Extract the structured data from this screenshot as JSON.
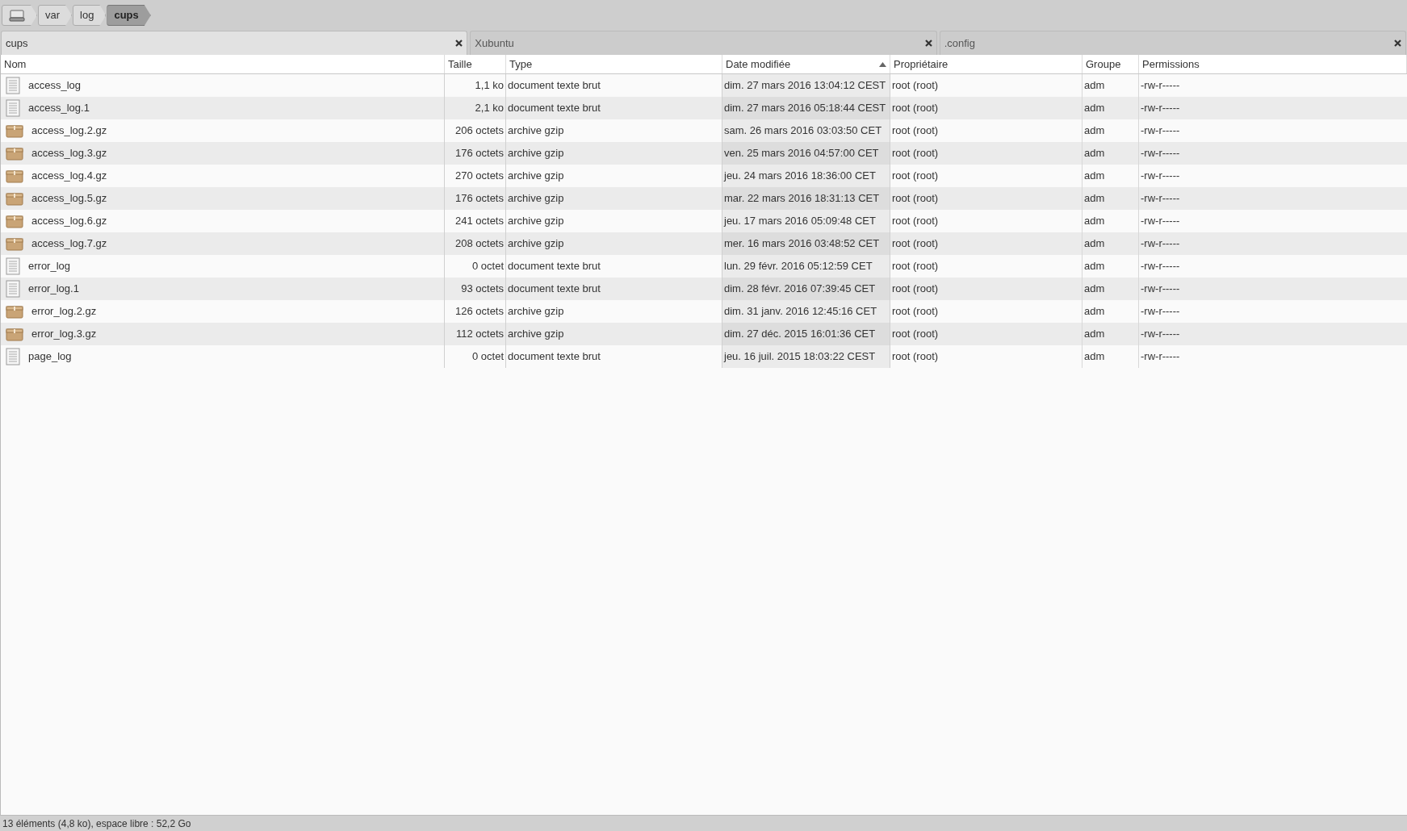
{
  "breadcrumb": [
    {
      "kind": "drive",
      "selected": false
    },
    {
      "kind": "folder",
      "label": "var",
      "selected": false
    },
    {
      "kind": "folder",
      "label": "log",
      "selected": false
    },
    {
      "kind": "folder",
      "label": "cups",
      "selected": true
    }
  ],
  "tabs": [
    {
      "label": "cups",
      "selected": true
    },
    {
      "label": "Xubuntu",
      "selected": false
    },
    {
      "label": ".config",
      "selected": false
    }
  ],
  "table": {
    "columns": [
      {
        "label": "Nom",
        "sorted": false
      },
      {
        "label": "Taille",
        "sorted": false
      },
      {
        "label": "Type",
        "sorted": false
      },
      {
        "label": "Date modifiée",
        "sorted": true
      },
      {
        "label": "Propriétaire",
        "sorted": false
      },
      {
        "label": "Groupe",
        "sorted": false
      },
      {
        "label": "Permissions",
        "sorted": false
      }
    ],
    "rows": [
      {
        "kind": "text",
        "cells": [
          "access_log",
          "1,1 ko",
          "document texte brut",
          "dim. 27 mars 2016 13:04:12 CEST",
          "root (root)",
          "adm",
          "-rw-r-----"
        ]
      },
      {
        "kind": "text",
        "cells": [
          "access_log.1",
          "2,1 ko",
          "document texte brut",
          "dim. 27 mars 2016 05:18:44 CEST",
          "root (root)",
          "adm",
          "-rw-r-----"
        ]
      },
      {
        "kind": "archive",
        "cells": [
          "access_log.2.gz",
          "206 octets",
          "archive gzip",
          "sam. 26 mars 2016 03:03:50 CET",
          "root (root)",
          "adm",
          "-rw-r-----"
        ]
      },
      {
        "kind": "archive",
        "cells": [
          "access_log.3.gz",
          "176 octets",
          "archive gzip",
          "ven. 25 mars 2016 04:57:00 CET",
          "root (root)",
          "adm",
          "-rw-r-----"
        ]
      },
      {
        "kind": "archive",
        "cells": [
          "access_log.4.gz",
          "270 octets",
          "archive gzip",
          "jeu. 24 mars 2016 18:36:00 CET",
          "root (root)",
          "adm",
          "-rw-r-----"
        ]
      },
      {
        "kind": "archive",
        "cells": [
          "access_log.5.gz",
          "176 octets",
          "archive gzip",
          "mar. 22 mars 2016 18:31:13 CET",
          "root (root)",
          "adm",
          "-rw-r-----"
        ]
      },
      {
        "kind": "archive",
        "cells": [
          "access_log.6.gz",
          "241 octets",
          "archive gzip",
          "jeu. 17 mars 2016 05:09:48 CET",
          "root (root)",
          "adm",
          "-rw-r-----"
        ]
      },
      {
        "kind": "archive",
        "cells": [
          "access_log.7.gz",
          "208 octets",
          "archive gzip",
          "mer. 16 mars 2016 03:48:52 CET",
          "root (root)",
          "adm",
          "-rw-r-----"
        ]
      },
      {
        "kind": "text",
        "cells": [
          "error_log",
          "0 octet",
          "document texte brut",
          "lun. 29 févr. 2016 05:12:59 CET",
          "root (root)",
          "adm",
          "-rw-r-----"
        ]
      },
      {
        "kind": "text",
        "cells": [
          "error_log.1",
          "93 octets",
          "document texte brut",
          "dim. 28 févr. 2016 07:39:45 CET",
          "root (root)",
          "adm",
          "-rw-r-----"
        ]
      },
      {
        "kind": "archive",
        "cells": [
          "error_log.2.gz",
          "126 octets",
          "archive gzip",
          "dim. 31 janv. 2016 12:45:16 CET",
          "root (root)",
          "adm",
          "-rw-r-----"
        ]
      },
      {
        "kind": "archive",
        "cells": [
          "error_log.3.gz",
          "112 octets",
          "archive gzip",
          "dim. 27 déc. 2015 16:01:36 CET",
          "root (root)",
          "adm",
          "-rw-r-----"
        ]
      },
      {
        "kind": "text",
        "cells": [
          "page_log",
          "0 octet",
          "document texte brut",
          "jeu. 16 juil. 2015 18:03:22 CEST",
          "root (root)",
          "adm",
          "-rw-r-----"
        ]
      }
    ]
  },
  "status_bar": "13 éléments (4,8 ko), espace libre : 52,2 Go"
}
